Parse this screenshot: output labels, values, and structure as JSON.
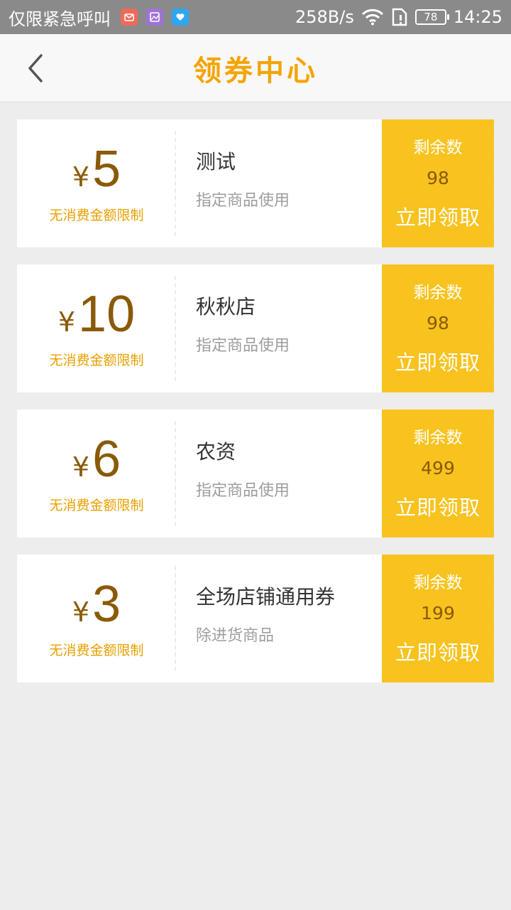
{
  "status_bar": {
    "carrier": "仅限紧急呼叫",
    "net_speed": "258B/s",
    "battery": "78",
    "time": "14:25",
    "icons": [
      "mail-app-icon",
      "gallery-app-icon",
      "heart-app-icon",
      "wifi-icon",
      "sim-icon",
      "battery-icon"
    ]
  },
  "header": {
    "title": "领券中心",
    "back_icon": "chevron-left-icon"
  },
  "colors": {
    "accent": "#f5a400",
    "claim_bg": "#f8c31f",
    "amount_text": "#8a5a06",
    "page_bg": "#ededed"
  },
  "coupons": [
    {
      "currency": "¥",
      "amount": "5",
      "limit": "无消费金额限制",
      "name": "测试",
      "scope": "指定商品使用",
      "remain_label": "剩余数",
      "remain": "98",
      "claim": "立即领取"
    },
    {
      "currency": "¥",
      "amount": "10",
      "limit": "无消费金额限制",
      "name": "秋秋店",
      "scope": "指定商品使用",
      "remain_label": "剩余数",
      "remain": "98",
      "claim": "立即领取"
    },
    {
      "currency": "¥",
      "amount": "6",
      "limit": "无消费金额限制",
      "name": "农资",
      "scope": "指定商品使用",
      "remain_label": "剩余数",
      "remain": "499",
      "claim": "立即领取"
    },
    {
      "currency": "¥",
      "amount": "3",
      "limit": "无消费金额限制",
      "name": "全场店铺通用券",
      "scope": "除进货商品",
      "remain_label": "剩余数",
      "remain": "199",
      "claim": "立即领取"
    }
  ]
}
